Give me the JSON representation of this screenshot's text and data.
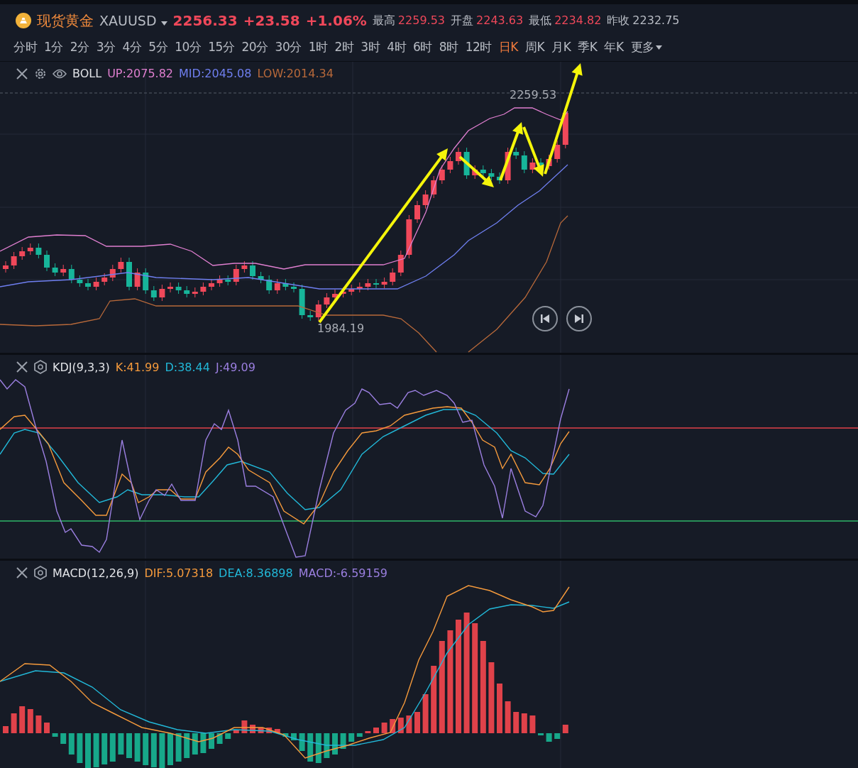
{
  "header": {
    "symbol_name": "现货黄金",
    "symbol_code": "XAUUSD",
    "price": "2256.33",
    "change": "+23.58",
    "change_percent": "+1.06%",
    "stats": [
      {
        "label": "最高",
        "value": "2259.53",
        "color": "#f0485a"
      },
      {
        "label": "开盘",
        "value": "2243.63",
        "color": "#f0485a"
      },
      {
        "label": "最低",
        "value": "2234.82",
        "color": "#f0485a"
      },
      {
        "label": "昨收",
        "value": "2232.75",
        "color": "#b8bcc4"
      }
    ]
  },
  "timeframes": [
    {
      "label": "分时",
      "selected": false
    },
    {
      "label": "1分",
      "selected": false
    },
    {
      "label": "2分",
      "selected": false
    },
    {
      "label": "3分",
      "selected": false
    },
    {
      "label": "4分",
      "selected": false
    },
    {
      "label": "5分",
      "selected": false
    },
    {
      "label": "10分",
      "selected": false
    },
    {
      "label": "15分",
      "selected": false
    },
    {
      "label": "20分",
      "selected": false
    },
    {
      "label": "30分",
      "selected": false
    },
    {
      "label": "1时",
      "selected": false
    },
    {
      "label": "2时",
      "selected": false
    },
    {
      "label": "3时",
      "selected": false
    },
    {
      "label": "4时",
      "selected": false
    },
    {
      "label": "6时",
      "selected": false
    },
    {
      "label": "8时",
      "selected": false
    },
    {
      "label": "12时",
      "selected": false
    },
    {
      "label": "日K",
      "selected": true
    },
    {
      "label": "周K",
      "selected": false
    },
    {
      "label": "月K",
      "selected": false
    },
    {
      "label": "季K",
      "selected": false
    },
    {
      "label": "年K",
      "selected": false
    }
  ],
  "more_menu": {
    "label": "更多"
  },
  "panels": [
    {
      "kind": "boll",
      "name": "BOLL",
      "values": [
        {
          "label": "UP:2075.82",
          "color": "#e07fd0"
        },
        {
          "label": "MID:2045.08",
          "color": "#6f7ff0"
        },
        {
          "label": "LOW:2014.34",
          "color": "#b8693a"
        }
      ],
      "high_label": "2259.53",
      "low_label": "1984.19"
    },
    {
      "kind": "kdj",
      "name": "KDJ(9,3,3)",
      "values": [
        {
          "label": "K:41.99",
          "color": "#f59a3c"
        },
        {
          "label": "D:38.44",
          "color": "#22b8d8"
        },
        {
          "label": "J:49.09",
          "color": "#9b7fe0"
        }
      ]
    },
    {
      "kind": "macd",
      "name": "MACD(12,26,9)",
      "values": [
        {
          "label": "DIF:5.07318",
          "color": "#f59a3c"
        },
        {
          "label": "DEA:8.36898",
          "color": "#22b8d8"
        },
        {
          "label": "MACD:-6.59159",
          "color": "#9b7fe0"
        }
      ]
    }
  ]
}
